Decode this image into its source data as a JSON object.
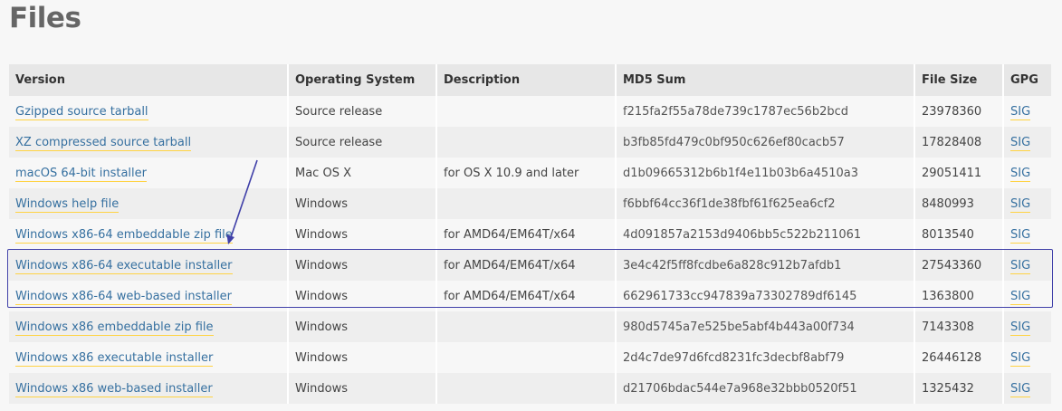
{
  "page": {
    "title": "Files"
  },
  "table": {
    "headers": [
      "Version",
      "Operating System",
      "Description",
      "MD5 Sum",
      "File Size",
      "GPG"
    ],
    "rows": [
      {
        "version": "Gzipped source tarball",
        "os": "Source release",
        "description": "",
        "md5": "f215fa2f55a78de739c1787ec56b2bcd",
        "size": "23978360",
        "gpg": "SIG"
      },
      {
        "version": "XZ compressed source tarball",
        "os": "Source release",
        "description": "",
        "md5": "b3fb85fd479c0bf950c626ef80cacb57",
        "size": "17828408",
        "gpg": "SIG"
      },
      {
        "version": "macOS 64-bit installer",
        "os": "Mac OS X",
        "description": "for OS X 10.9 and later",
        "md5": "d1b09665312b6b1f4e11b03b6a4510a3",
        "size": "29051411",
        "gpg": "SIG"
      },
      {
        "version": "Windows help file",
        "os": "Windows",
        "description": "",
        "md5": "f6bbf64cc36f1de38fbf61f625ea6cf2",
        "size": "8480993",
        "gpg": "SIG"
      },
      {
        "version": "Windows x86-64 embeddable zip file",
        "os": "Windows",
        "description": "for AMD64/EM64T/x64",
        "md5": "4d091857a2153d9406bb5c522b211061",
        "size": "8013540",
        "gpg": "SIG"
      },
      {
        "version": "Windows x86-64 executable installer",
        "os": "Windows",
        "description": "for AMD64/EM64T/x64",
        "md5": "3e4c42f5ff8fcdbe6a828c912b7afdb1",
        "size": "27543360",
        "gpg": "SIG"
      },
      {
        "version": "Windows x86-64 web-based installer",
        "os": "Windows",
        "description": "for AMD64/EM64T/x64",
        "md5": "662961733cc947839a73302789df6145",
        "size": "1363800",
        "gpg": "SIG"
      },
      {
        "version": "Windows x86 embeddable zip file",
        "os": "Windows",
        "description": "",
        "md5": "980d5745a7e525be5abf4b443a00f734",
        "size": "7143308",
        "gpg": "SIG"
      },
      {
        "version": "Windows x86 executable installer",
        "os": "Windows",
        "description": "",
        "md5": "2d4c7de97d6fcd8231fc3decbf8abf79",
        "size": "26446128",
        "gpg": "SIG"
      },
      {
        "version": "Windows x86 web-based installer",
        "os": "Windows",
        "description": "",
        "md5": "d21706bdac544e7a968e32bbb0520f51",
        "size": "1325432",
        "gpg": "SIG"
      }
    ]
  },
  "annotation": {
    "color": "#3f3fa8"
  }
}
